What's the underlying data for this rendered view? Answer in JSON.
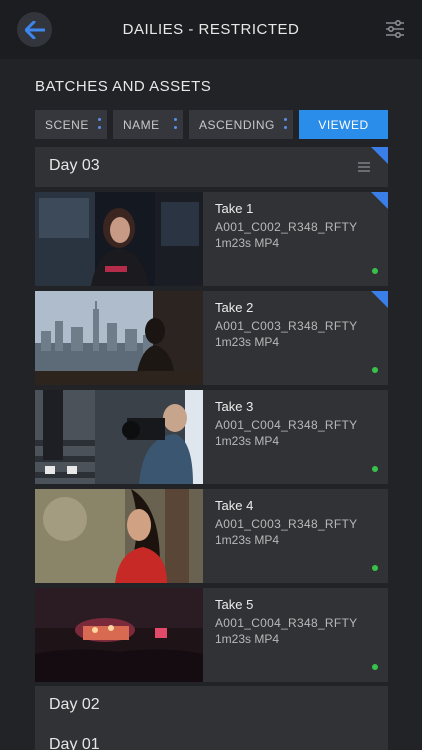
{
  "header": {
    "title": "DAILIES - RESTRICTED",
    "back_icon": "arrow-left-icon",
    "settings_icon": "sliders-icon"
  },
  "section": {
    "title": "BATCHES AND ASSETS"
  },
  "filters": [
    {
      "label": "SCENE"
    },
    {
      "label": "NAME"
    },
    {
      "label": "ASCENDING"
    }
  ],
  "viewed_label": "VIEWED",
  "days": [
    {
      "label": "Day 03"
    },
    {
      "label": "Day 02"
    },
    {
      "label": "Day 01"
    }
  ],
  "takes": [
    {
      "title": "Take 1",
      "code": "A001_C002_R348_RFTY",
      "meta": "1m23s MP4",
      "new": true,
      "status_color": "#39c24a"
    },
    {
      "title": "Take 2",
      "code": "A001_C003_R348_RFTY",
      "meta": "1m23s MP4",
      "new": true,
      "status_color": "#39c24a"
    },
    {
      "title": "Take 3",
      "code": "A001_C004_R348_RFTY",
      "meta": "1m23s MP4",
      "new": false,
      "status_color": "#39c24a"
    },
    {
      "title": "Take 4",
      "code": "A001_C003_R348_RFTY",
      "meta": "1m23s MP4",
      "new": false,
      "status_color": "#39c24a"
    },
    {
      "title": "Take 5",
      "code": "A001_C004_R348_RFTY",
      "meta": "1m23s MP4",
      "new": false,
      "status_color": "#39c24a"
    }
  ],
  "colors": {
    "accent": "#2a8dea",
    "corner": "#3a7ee8",
    "status": "#39c24a"
  }
}
